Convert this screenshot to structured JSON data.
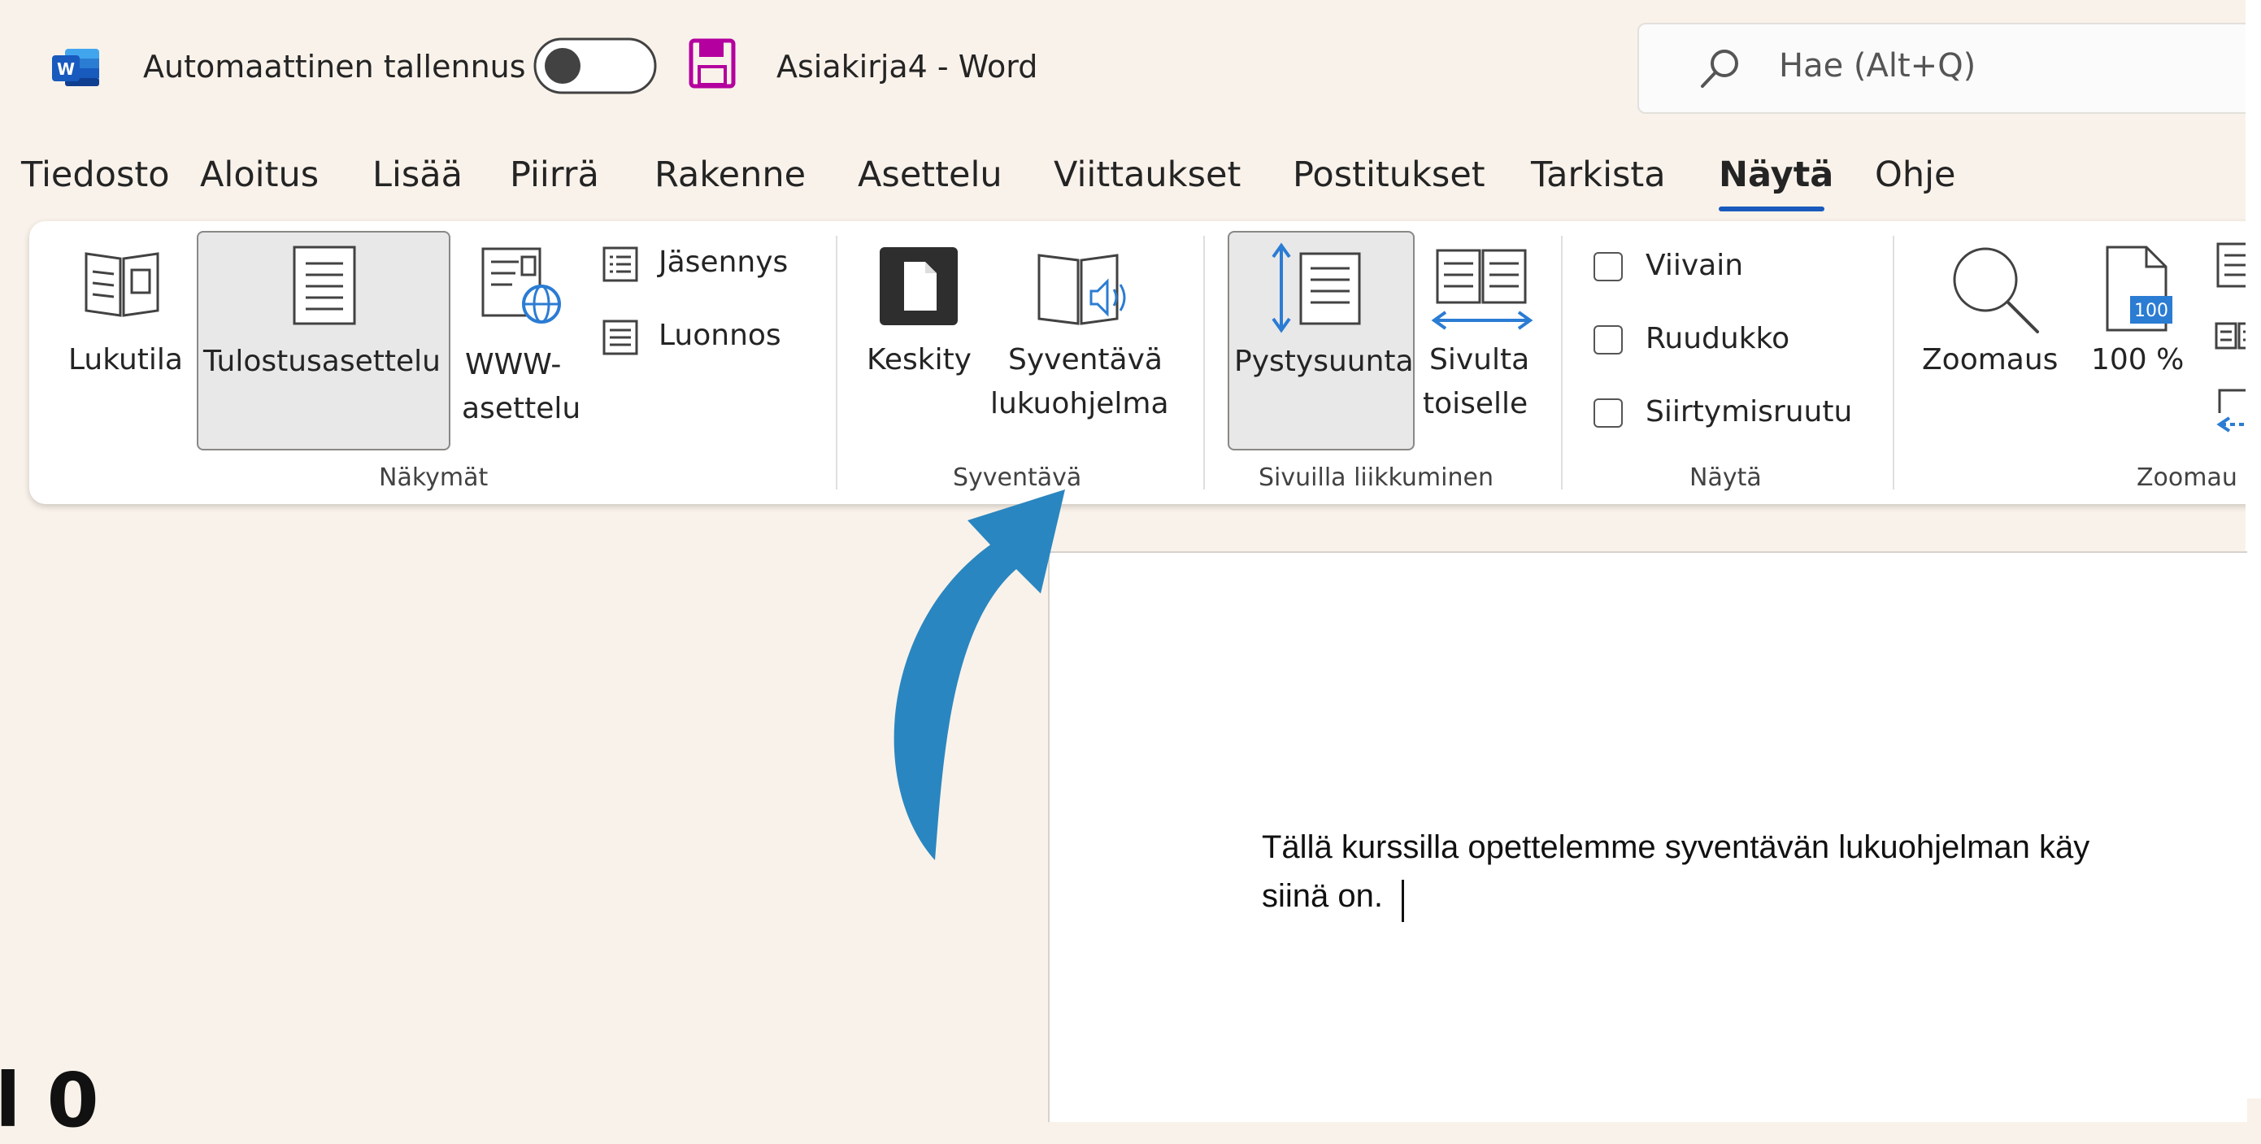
{
  "titlebar": {
    "autosave_label": "Automaattinen tallennus",
    "doc_title": "Asiakirja4  -  Word",
    "search_placeholder": "Hae (Alt+Q)"
  },
  "menu": [
    "Tiedosto",
    "Aloitus",
    "Lisää",
    "Piirrä",
    "Rakenne",
    "Asettelu",
    "Viittaukset",
    "Postitukset",
    "Tarkista",
    "Näytä",
    "Ohje"
  ],
  "active_tab": "Näytä",
  "ribbon": {
    "nakymat": {
      "group_label": "Näkymät",
      "lukutila": "Lukutila",
      "tulostus": "Tulostusasettelu",
      "www_line1": "WWW-",
      "www_line2": "asettelu",
      "jasennys": "Jäsennys",
      "luonnos": "Luonnos"
    },
    "syventava": {
      "group_label": "Syventävä",
      "keskity": "Keskity",
      "reader_line1": "Syventävä",
      "reader_line2": "lukuohjelma"
    },
    "sivuilla": {
      "group_label": "Sivuilla liikkuminen",
      "pystysuunta": "Pystysuunta",
      "sivulta_line1": "Sivulta",
      "sivulta_line2": "toiselle"
    },
    "nayta": {
      "group_label": "Näytä",
      "viivain": "Viivain",
      "ruudukko": "Ruudukko",
      "siirtymisruutu": "Siirtymisruutu"
    },
    "zoomaus": {
      "group_label": "Zoomau",
      "zoomaus": "Zoomaus",
      "percent": "100 %",
      "icon_number": "100"
    }
  },
  "document": {
    "line1": "Tällä kurssilla opettelemme syventävän lukuohjelman käy",
    "line2": "siinä on."
  },
  "corner_fragment": "l 0",
  "colors": {
    "arrow": "#2a86c0",
    "accent": "#185abd",
    "save": "#b4009e"
  }
}
